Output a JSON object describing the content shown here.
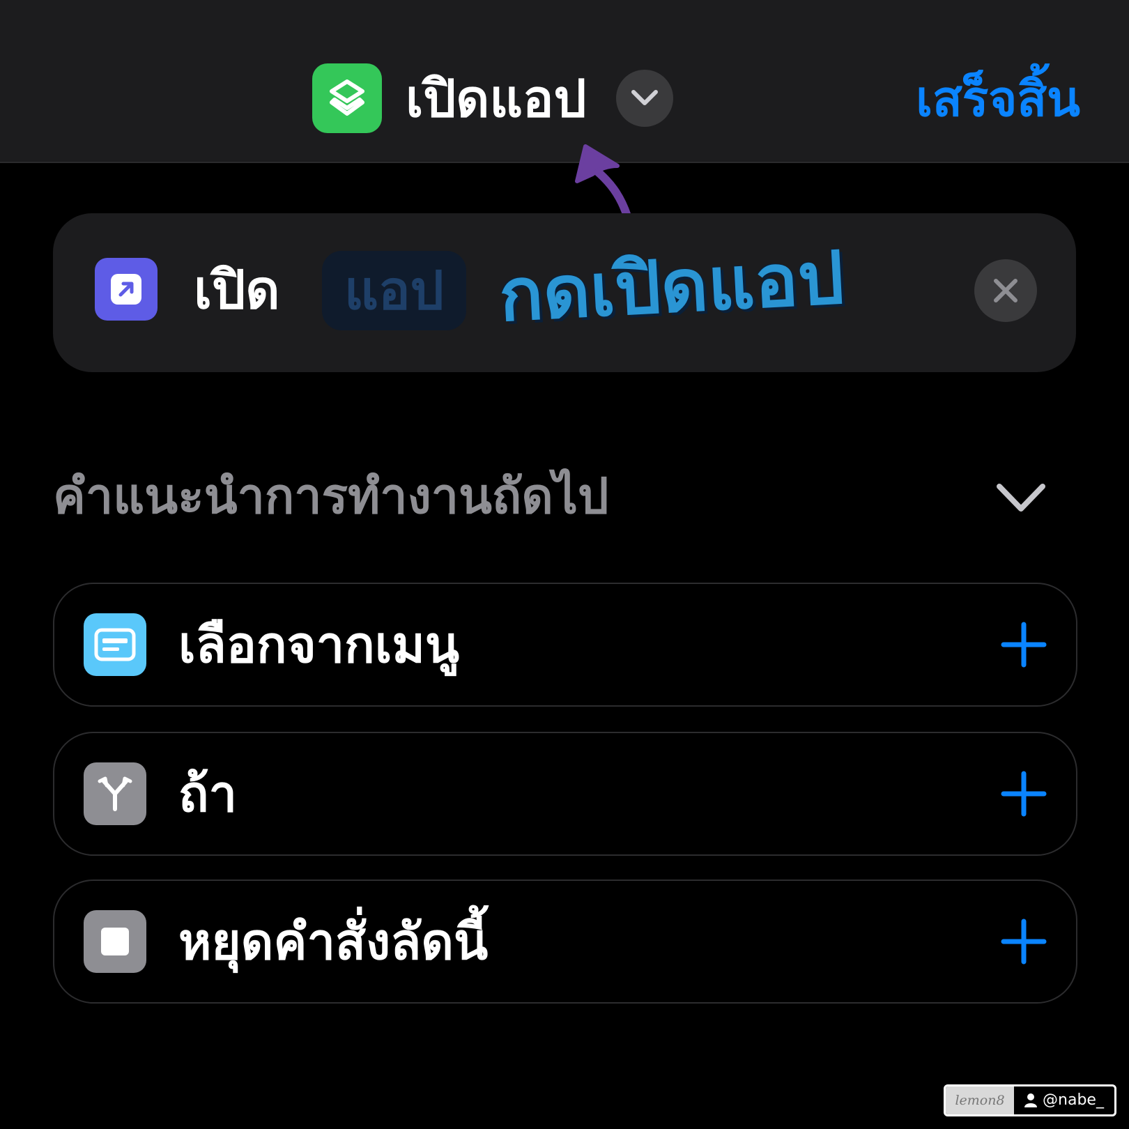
{
  "header": {
    "title": "เปิดแอป",
    "done_label": "เสร็จสิ้น",
    "app_icon": "shortcuts-layers-icon",
    "accent_color": "#0a84ff"
  },
  "action": {
    "verb": "เปิด",
    "parameter_placeholder": "แอป",
    "icon": "open-app-arrow-icon",
    "icon_color": "#5e5ce6"
  },
  "annotation": {
    "text": "กดเปิดแอป",
    "color": "#2a95d4",
    "arrow_color": "#6b3fa0"
  },
  "suggestions": {
    "title": "คำแนะนำการทำงานถัดไป",
    "items": [
      {
        "label": "เลือกจากเมนู",
        "icon": "menu-list-icon",
        "icon_color": "#5ac8fa"
      },
      {
        "label": "ถ้า",
        "icon": "branch-icon",
        "icon_color": "#8e8e93"
      },
      {
        "label": "หยุดคำสั่งลัดนี้",
        "icon": "stop-icon",
        "icon_color": "#8e8e93"
      }
    ]
  },
  "watermark": {
    "brand": "lemon8",
    "user": "@nabe_"
  }
}
